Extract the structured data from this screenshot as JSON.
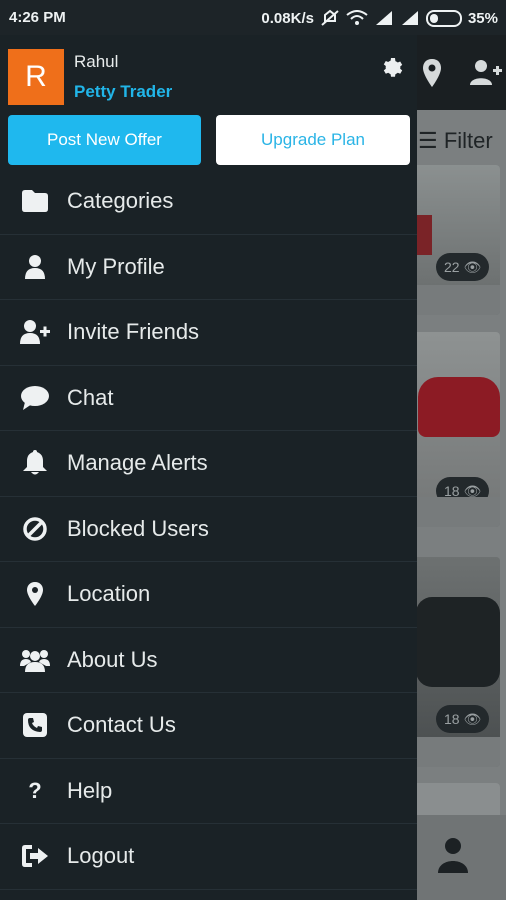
{
  "status_bar": {
    "time": "4:26 PM",
    "network_speed": "0.08K/s",
    "battery": "35%"
  },
  "background": {
    "filter_label": "Filter",
    "view_counts": [
      "22",
      "18",
      "18"
    ]
  },
  "drawer": {
    "avatar_initial": "R",
    "user_name": "Rahul",
    "plan_name": "Petty Trader",
    "post_button": "Post New Offer",
    "upgrade_button": "Upgrade Plan",
    "menu": [
      {
        "label": "Categories",
        "icon": "folder-icon"
      },
      {
        "label": "My Profile",
        "icon": "user-icon"
      },
      {
        "label": "Invite Friends",
        "icon": "user-plus-icon"
      },
      {
        "label": "Chat",
        "icon": "chat-icon"
      },
      {
        "label": "Manage Alerts",
        "icon": "bell-icon"
      },
      {
        "label": "Blocked Users",
        "icon": "block-icon"
      },
      {
        "label": "Location",
        "icon": "location-pin-icon"
      },
      {
        "label": "About Us",
        "icon": "group-icon"
      },
      {
        "label": "Contact Us",
        "icon": "phone-icon"
      },
      {
        "label": "Help",
        "icon": "question-icon"
      },
      {
        "label": "Logout",
        "icon": "logout-icon"
      }
    ]
  },
  "colors": {
    "drawer_bg": "#1a2226",
    "accent": "#1fb8ee",
    "avatar": "#ef6f1a"
  }
}
